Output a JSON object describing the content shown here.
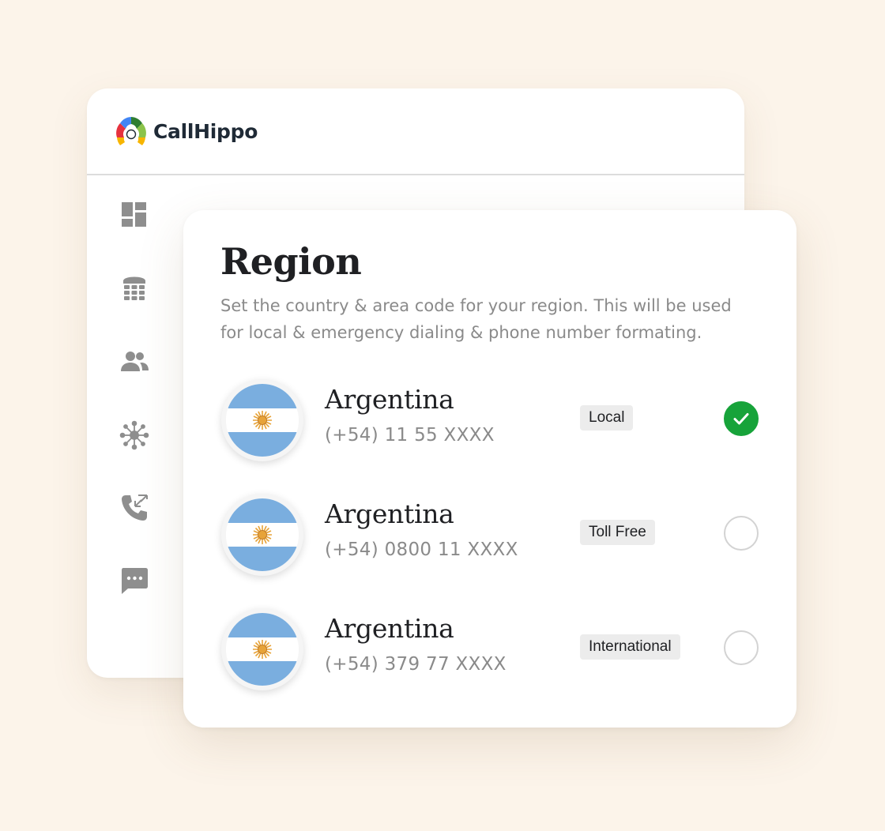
{
  "brand": {
    "name": "CallHippo"
  },
  "sidebar": {
    "items": [
      {
        "icon": "dashboard-icon"
      },
      {
        "icon": "dialpad-icon"
      },
      {
        "icon": "contacts-icon"
      },
      {
        "icon": "integrations-icon"
      },
      {
        "icon": "call-logs-icon"
      },
      {
        "icon": "messages-icon"
      }
    ]
  },
  "region": {
    "title": "Region",
    "description": "Set the country & area code for your region. This will be used for local & emergency dialing & phone number formating.",
    "options": [
      {
        "country": "Argentina",
        "number": "(+54) 11 55 XXXX",
        "type": "Local",
        "selected": true
      },
      {
        "country": "Argentina",
        "number": "(+54) 0800 11 XXXX",
        "type": "Toll Free",
        "selected": false
      },
      {
        "country": "Argentina",
        "number": "(+54) 379 77 XXXX",
        "type": "International",
        "selected": false
      }
    ]
  },
  "colors": {
    "background": "#fcf4ea",
    "selected": "#17a33a",
    "flag_blue": "#7aaedf",
    "sun": "#e7a339"
  }
}
